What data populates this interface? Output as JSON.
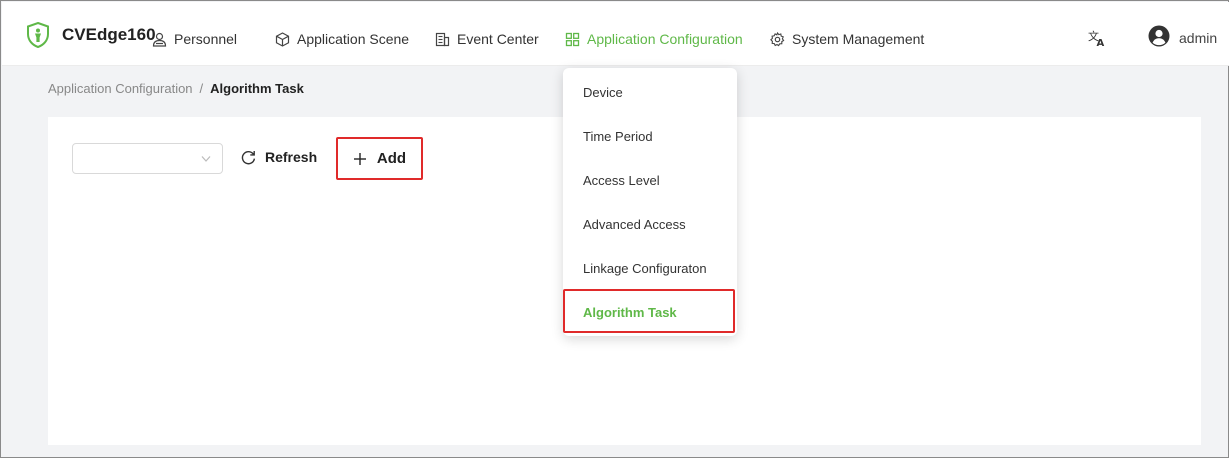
{
  "app": {
    "brand": "CVEdge160"
  },
  "nav": {
    "items": [
      {
        "label": "Personnel",
        "icon": "user-icon"
      },
      {
        "label": "Application Scene",
        "icon": "cube-icon"
      },
      {
        "label": "Event Center",
        "icon": "building-icon"
      },
      {
        "label": "Application Configuration",
        "icon": "grid-icon",
        "active": true
      },
      {
        "label": "System Management",
        "icon": "gear-icon"
      }
    ]
  },
  "user": {
    "name": "admin"
  },
  "breadcrumb": {
    "parent": "Application Configuration",
    "separator": "/",
    "current": "Algorithm Task"
  },
  "toolbar": {
    "select_value": "",
    "refresh_label": "Refresh",
    "add_label": "Add"
  },
  "dropdown": {
    "items": [
      {
        "label": "Device"
      },
      {
        "label": "Time Period"
      },
      {
        "label": "Access Level"
      },
      {
        "label": "Advanced Access"
      },
      {
        "label": "Linkage Configuraton"
      },
      {
        "label": "Algorithm Task",
        "active": true
      }
    ]
  },
  "colors": {
    "accent": "#5fb848",
    "highlight": "#e02a2a",
    "background": "#f2f3f5"
  }
}
